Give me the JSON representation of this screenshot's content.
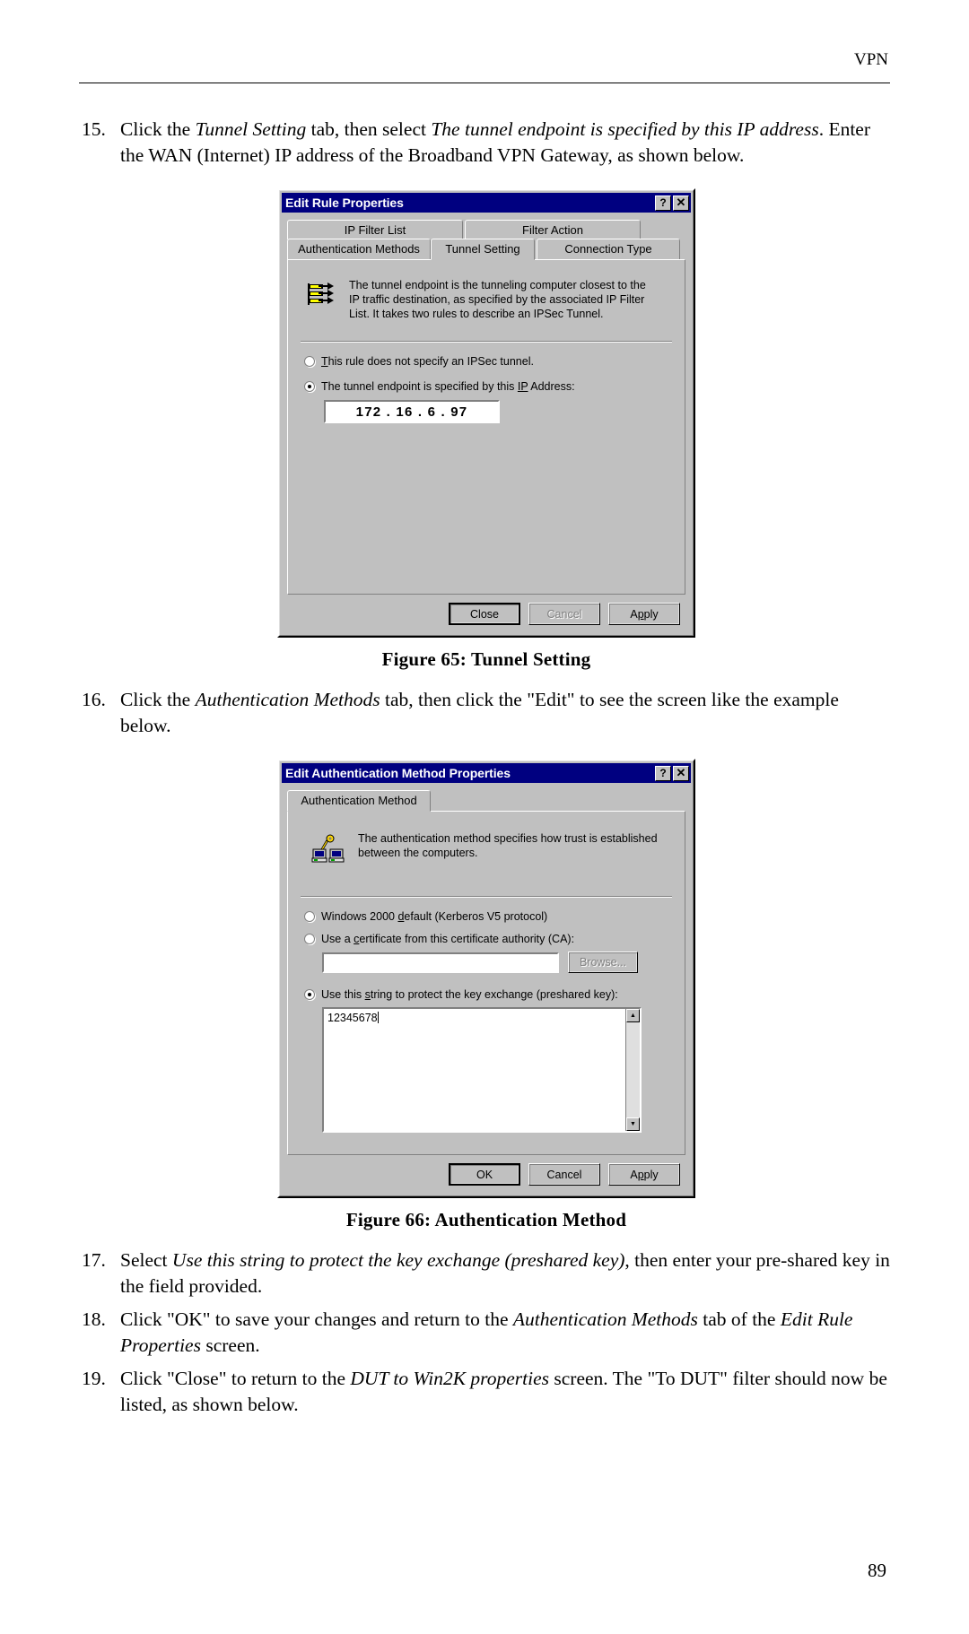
{
  "page": {
    "running_head": "VPN",
    "page_number": "89"
  },
  "steps": {
    "s15": {
      "num": "15.",
      "p1": "Click the ",
      "i1": "Tunnel Setting",
      "p2": " tab, then select ",
      "i2": "The tunnel endpoint is specified by this IP address",
      "p3": ". Enter the WAN (Internet) IP address of the Broadband VPN Gateway, as shown below."
    },
    "s16": {
      "num": "16.",
      "p1": "Click the ",
      "i1": "Authentication Methods",
      "p2": " tab, then click the \"Edit\" to see the screen like the example below."
    },
    "s17": {
      "num": "17.",
      "p1": "Select ",
      "i1": "Use this string to protect the key exchange (preshared key)",
      "p2": ", then enter your pre-shared key in the field provided."
    },
    "s18": {
      "num": "18.",
      "p1": "Click \"OK\" to save your changes and return to the ",
      "i1": "Authentication Methods",
      "p2": " tab of the ",
      "i2": "Edit Rule Properties",
      "p3": " screen."
    },
    "s19": {
      "num": "19.",
      "p1": "Click \"Close\" to return to the ",
      "i1": "DUT to Win2K properties",
      "p2": " screen. The \"To DUT\" filter should now be listed, as shown below."
    }
  },
  "captions": {
    "fig65": "Figure 65: Tunnel Setting",
    "fig66": "Figure 66: Authentication Method"
  },
  "dialog_tunnel": {
    "title": "Edit Rule Properties",
    "help_button": "?",
    "close_button": "✕",
    "tabs_top": [
      "IP Filter List",
      "Filter Action"
    ],
    "tabs_bottom": [
      "Authentication Methods",
      "Tunnel Setting",
      "Connection Type"
    ],
    "active_tab": "Tunnel Setting",
    "info_text_line1": "The tunnel endpoint is the tunneling computer closest to the",
    "info_text_line2": "IP traffic destination, as specified by the associated IP Filter",
    "info_text_line3": "List. It takes two rules to describe an IPSec Tunnel.",
    "radio_no_tunnel": {
      "label_accel": "T",
      "label_rest": "his rule does not specify an IPSec tunnel.",
      "selected": false
    },
    "radio_endpoint": {
      "label_pre": "The tunnel endpoint is specified by this ",
      "label_accel": "IP",
      "label_post": " Address:",
      "selected": true
    },
    "ip_value": "172 . 16 .  6  . 97",
    "buttons": {
      "close": "Close",
      "cancel": "Cancel",
      "apply_pre": "A",
      "apply_accel": "p",
      "apply_post": "ply"
    }
  },
  "dialog_auth": {
    "title": "Edit Authentication Method Properties",
    "help_button": "?",
    "close_button": "✕",
    "tab": "Authentication Method",
    "info_text_line1": "The authentication method specifies how trust is established",
    "info_text_line2": "between the computers.",
    "radio_kerberos": {
      "label_pre": "Windows 2000 ",
      "label_accel": "d",
      "label_post": "efault (Kerberos V5 protocol)",
      "selected": false
    },
    "radio_ca": {
      "label_pre": "Use a ",
      "label_accel": "c",
      "label_post": "ertificate from this certificate authority (CA):",
      "selected": false
    },
    "ca_field_value": "",
    "browse_button": "Browse...",
    "radio_preshared": {
      "label_pre": "Use this ",
      "label_accel": "s",
      "label_post": "tring to protect the key exchange (preshared key):",
      "selected": true
    },
    "preshared_value": "12345678",
    "buttons": {
      "ok": "OK",
      "cancel": "Cancel",
      "apply_pre": "A",
      "apply_accel": "p",
      "apply_post": "ply"
    }
  }
}
